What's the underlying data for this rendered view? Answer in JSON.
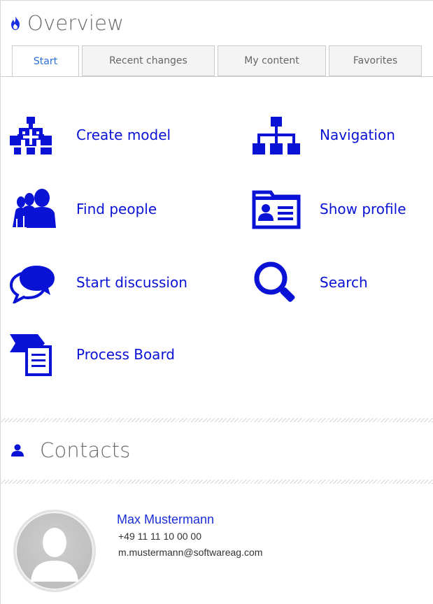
{
  "overview": {
    "title": "Overview",
    "icon": "flame-icon",
    "tabs": [
      {
        "label": "Start",
        "active": true
      },
      {
        "label": "Recent changes",
        "active": false
      },
      {
        "label": "My content",
        "active": false
      },
      {
        "label": "Favorites",
        "active": false
      }
    ],
    "actions": {
      "create_model": {
        "label": "Create model",
        "icon": "create-model-icon"
      },
      "navigation": {
        "label": "Navigation",
        "icon": "hierarchy-icon"
      },
      "find_people": {
        "label": "Find people",
        "icon": "people-icon"
      },
      "show_profile": {
        "label": "Show profile",
        "icon": "profile-card-icon"
      },
      "start_discussion": {
        "label": "Start discussion",
        "icon": "speech-bubbles-icon"
      },
      "search": {
        "label": "Search",
        "icon": "search-icon"
      },
      "process_board": {
        "label": "Process Board",
        "icon": "process-board-icon"
      }
    }
  },
  "contacts": {
    "title": "Contacts",
    "icon": "person-icon",
    "items": [
      {
        "name": "Max Mustermann",
        "phone": "+49 11 11 10 00 00",
        "email": "m.mustermann@softwareag.com",
        "avatar": "default-avatar-icon"
      }
    ]
  },
  "colors": {
    "accent": "#0a12d6",
    "active_tab_text": "#2a6fd6",
    "title_text": "#6b6b6b",
    "flame": "#1a2fe0"
  }
}
